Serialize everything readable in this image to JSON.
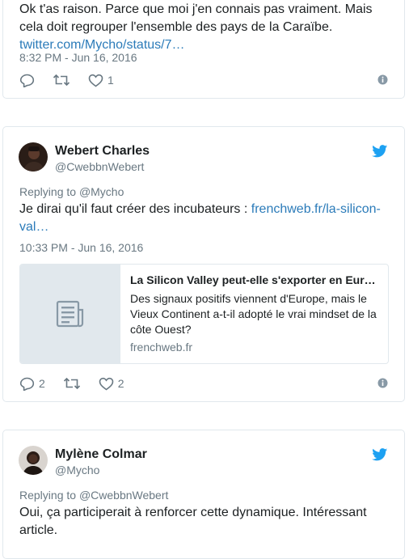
{
  "tweets": [
    {
      "text_line1": "Ok t'as raison. Parce que moi j'en connais pas vraiment. Mais",
      "text_line2": "cela doit regrouper l'ensemble des pays de la Caraïbe.",
      "link": "twitter.com/Mycho/status/7…",
      "timestamp": "8:32 PM - Jun 16, 2016",
      "replies": "",
      "retweets": "",
      "likes": "1"
    },
    {
      "name": "Webert Charles",
      "handle": "@CwebbnWebert",
      "replying_prefix": "Replying to ",
      "replying_to": "@Mycho",
      "text": "Je dirai qu'il faut créer des incubateurs : ",
      "link_part1": "frenchweb.fr/la-silicon-",
      "link_part2": "val…",
      "timestamp": "10:33 PM - Jun 16, 2016",
      "card": {
        "title": "La Silicon Valley peut-elle s'exporter en Eur…",
        "description": "Des signaux positifs viennent d'Europe, mais le Vieux Continent a-t-il adopté le vrai mindset de la côte Ouest?",
        "domain": "frenchweb.fr"
      },
      "replies": "2",
      "retweets": "",
      "likes": "2"
    },
    {
      "name": "Mylène Colmar",
      "handle": "@Mycho",
      "replying_prefix": "Replying to ",
      "replying_to": "@CwebbnWebert",
      "text_line1": "Oui, ça participerait à renforcer cette dynamique. Intéressant",
      "text_line2": "article."
    }
  ],
  "colors": {
    "link": "#2b7bb9",
    "twitter_blue": "#1da1f2",
    "meta_gray": "#697882",
    "border": "#e1e8ed"
  }
}
